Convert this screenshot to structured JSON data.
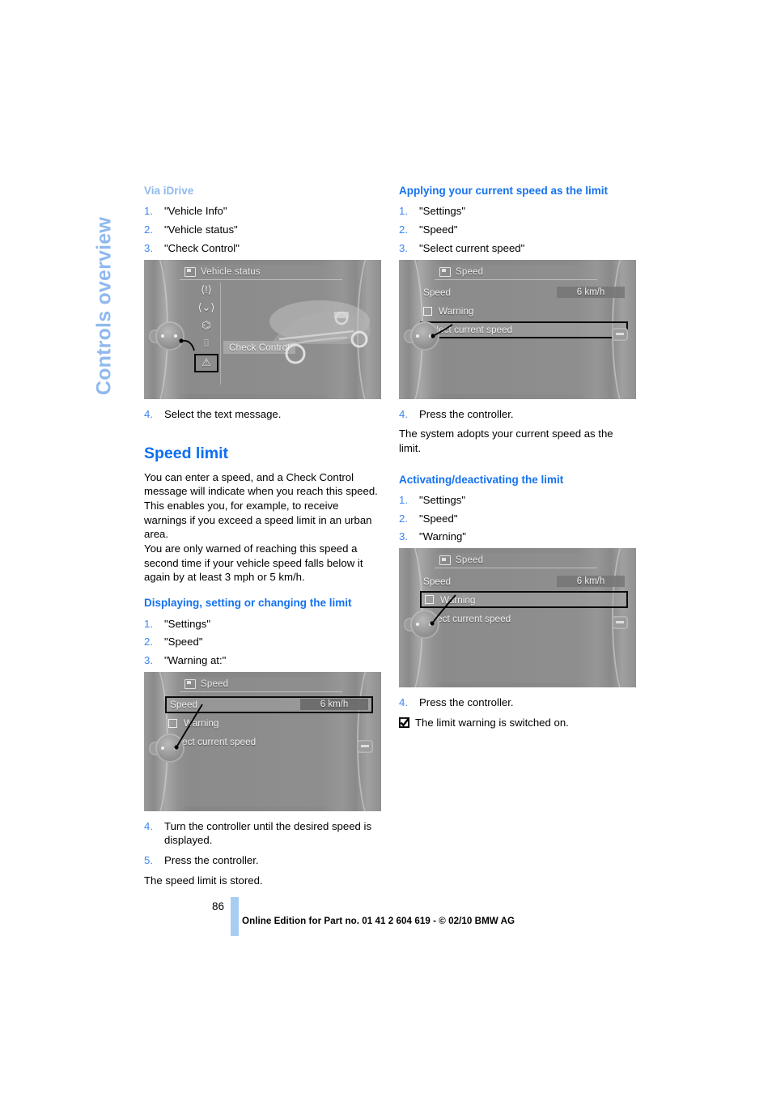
{
  "chapter": {
    "tab_label": "Controls overview"
  },
  "left_column": {
    "via_idrive": {
      "heading": "Via iDrive",
      "steps": [
        {
          "num": "1.",
          "text": "\"Vehicle Info\""
        },
        {
          "num": "2.",
          "text": "\"Vehicle status\""
        },
        {
          "num": "3.",
          "text": "\"Check Control\""
        }
      ],
      "figure": {
        "title": "Vehicle status",
        "tooltip": "Check Control",
        "icons": [
          "tire-pressure-icon",
          "tire-condition-icon",
          "oil-level-icon",
          "vehicle-icon",
          "warning-triangle-icon"
        ],
        "selected_icon": "warning-triangle-icon"
      },
      "step4": {
        "num": "4.",
        "text": "Select the text message."
      }
    },
    "speed_limit": {
      "heading": "Speed limit",
      "paragraph_1": "You can enter a speed, and a Check Control message will indicate when you reach this speed. This enables you, for example, to receive warnings if you exceed a speed limit in an urban area.",
      "paragraph_2": "You are only warned of reaching this speed a second time if your vehicle speed falls below it again by at least 3 mph or 5 km/h."
    },
    "displaying": {
      "heading": "Displaying, setting or changing the limit",
      "steps": [
        {
          "num": "1.",
          "text": "\"Settings\""
        },
        {
          "num": "2.",
          "text": "\"Speed\""
        },
        {
          "num": "3.",
          "text": "\"Warning at:\""
        }
      ],
      "figure": {
        "title": "Speed",
        "rows": [
          {
            "label": "Speed",
            "value": "6 km/h",
            "selected": true,
            "checkbox": false
          },
          {
            "label": "Warning",
            "value": "",
            "selected": false,
            "checkbox": true
          },
          {
            "label": "Select current speed",
            "value": "",
            "selected": false,
            "checkbox": false
          }
        ]
      },
      "steps_after": [
        {
          "num": "4.",
          "text": "Turn the controller until the desired speed is displayed."
        },
        {
          "num": "5.",
          "text": "Press the controller."
        }
      ],
      "result": "The speed limit is stored."
    }
  },
  "right_column": {
    "applying": {
      "heading": "Applying your current speed as the limit",
      "steps": [
        {
          "num": "1.",
          "text": "\"Settings\""
        },
        {
          "num": "2.",
          "text": "\"Speed\""
        },
        {
          "num": "3.",
          "text": "\"Select current speed\""
        }
      ],
      "figure": {
        "title": "Speed",
        "rows": [
          {
            "label": "Speed",
            "value": "6 km/h",
            "selected": false,
            "checkbox": false
          },
          {
            "label": "Warning",
            "value": "",
            "selected": false,
            "checkbox": true
          },
          {
            "label": "Select current speed",
            "value": "",
            "selected": true,
            "checkbox": false
          }
        ]
      },
      "step4": {
        "num": "4.",
        "text": "Press the controller."
      },
      "result": "The system adopts your current speed as the limit."
    },
    "activating": {
      "heading": "Activating/deactivating the limit",
      "steps": [
        {
          "num": "1.",
          "text": "\"Settings\""
        },
        {
          "num": "2.",
          "text": "\"Speed\""
        },
        {
          "num": "3.",
          "text": "\"Warning\""
        }
      ],
      "figure": {
        "title": "Speed",
        "rows": [
          {
            "label": "Speed",
            "value": "6 km/h",
            "selected": false,
            "checkbox": false
          },
          {
            "label": "Warning",
            "value": "",
            "selected": true,
            "checkbox": true
          },
          {
            "label": "Select current speed",
            "value": "",
            "selected": false,
            "checkbox": false
          }
        ]
      },
      "step4": {
        "num": "4.",
        "text": "Press the controller."
      },
      "note": {
        "icon": "checked-checkbox-icon",
        "text": "The limit warning is switched on."
      }
    }
  },
  "footer": {
    "page_number": "86",
    "imprint": "Online Edition for Part no. 01 41 2 604 619 - © 02/10 BMW AG"
  },
  "colors": {
    "heading_blue": "#0a6ef2",
    "subheading_blue_light": "#8fb9ee",
    "subheading_blue_strong": "#1572f0",
    "list_number_blue": "#3d87f0",
    "footer_bar_blue": "#a8cdf3"
  }
}
